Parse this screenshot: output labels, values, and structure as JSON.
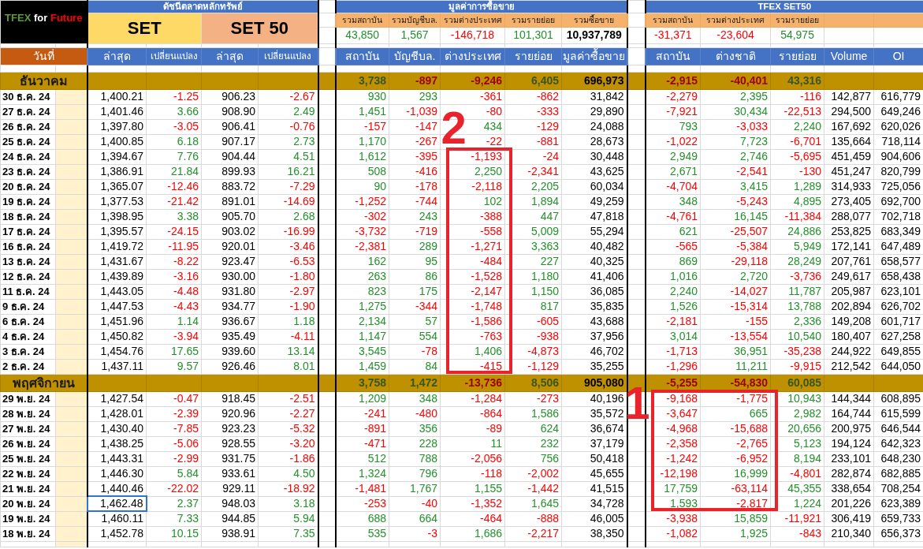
{
  "logo": [
    {
      "text": "TFEX",
      "color": "#5b9b3a"
    },
    {
      "text": "for",
      "color": "#ffffff"
    },
    {
      "text": "Future",
      "color": "#ff0000"
    }
  ],
  "date_header": "วันที่",
  "set_section": {
    "title": "ดัชนีตลาดหลักทรัพย์",
    "indices": [
      {
        "name": "SET",
        "columns": [
          "ล่าสุด",
          "เปลี่ยนแปลง"
        ]
      },
      {
        "name": "SET 50",
        "columns": [
          "ล่าสุด",
          "เปลี่ยนแปลง"
        ]
      }
    ]
  },
  "flow_section": {
    "title": "มูลค่าการซื้อขาย",
    "summary_labels": [
      "รวมสถาบัน",
      "รวมบัญชีบล.",
      "รวมต่างประเทศ",
      "รวมรายย่อย",
      "รวมซื้อขาย"
    ],
    "summary_values": [
      "43,850",
      "1,567",
      "-146,718",
      "101,301",
      "10,937,789"
    ],
    "columns": [
      "สถาบัน",
      "บัญชีบล.",
      "ต่างประเทศ",
      "รายย่อย",
      "มูลค่าซื้อขาย"
    ]
  },
  "tfex_section": {
    "title": "TFEX SET50",
    "summary_labels": [
      "รวมสถาบัน",
      "รวมต่างประเทศ",
      "รวมรายย่อย"
    ],
    "summary_values": [
      "-31,371",
      "-23,604",
      "54,975"
    ],
    "columns": [
      "สถาบัน",
      "ต่างชาติ",
      "รายย่อย",
      "Volume",
      "OI"
    ]
  },
  "months": [
    {
      "name": "ธันวาคม",
      "flow_totals": [
        "3,738",
        "-897",
        "-9,246",
        "6,405",
        "696,973"
      ],
      "tfex_totals": [
        "-2,915",
        "-40,401",
        "43,316"
      ],
      "rows": [
        {
          "date": "30 ธ.ค. 24",
          "set": [
            "1,400.21",
            "-1.25"
          ],
          "set50": [
            "906.23",
            "-2.67"
          ],
          "flow": [
            "930",
            "293",
            "-361",
            "-862",
            "31,842"
          ],
          "tfex": [
            "-2,279",
            "2,395",
            "-116",
            "142,877",
            "616,779"
          ],
          "selected": false
        },
        {
          "date": "27 ธ.ค. 24",
          "set": [
            "1,401.46",
            "3.66"
          ],
          "set50": [
            "908.90",
            "2.49"
          ],
          "flow": [
            "1,451",
            "-1,039",
            "-80",
            "-333",
            "29,890"
          ],
          "tfex": [
            "-7,921",
            "30,434",
            "-22,513",
            "294,500",
            "649,246"
          ],
          "selected": false
        },
        {
          "date": "26 ธ.ค. 24",
          "set": [
            "1,397.80",
            "-3.05"
          ],
          "set50": [
            "906.41",
            "-0.76"
          ],
          "flow": [
            "-157",
            "-147",
            "434",
            "-129",
            "24,088"
          ],
          "tfex": [
            "793",
            "-3,033",
            "2,240",
            "167,692",
            "620,026"
          ],
          "selected": false
        },
        {
          "date": "25 ธ.ค. 24",
          "set": [
            "1,400.85",
            "6.18"
          ],
          "set50": [
            "907.17",
            "2.73"
          ],
          "flow": [
            "1,170",
            "-267",
            "-22",
            "-881",
            "28,673"
          ],
          "tfex": [
            "-1,022",
            "7,723",
            "-6,701",
            "135,664",
            "718,114"
          ],
          "selected": false
        },
        {
          "date": "24 ธ.ค. 24",
          "set": [
            "1,394.67",
            "7.76"
          ],
          "set50": [
            "904.44",
            "4.51"
          ],
          "flow": [
            "1,612",
            "-395",
            "-1,193",
            "-24",
            "30,448"
          ],
          "tfex": [
            "2,949",
            "2,746",
            "-5,695",
            "451,459",
            "904,606"
          ],
          "selected": false
        },
        {
          "date": "23 ธ.ค. 24",
          "set": [
            "1,386.91",
            "21.84"
          ],
          "set50": [
            "899.93",
            "16.21"
          ],
          "flow": [
            "508",
            "-416",
            "2,250",
            "-2,341",
            "43,625"
          ],
          "tfex": [
            "2,671",
            "-2,541",
            "-130",
            "451,247",
            "820,799"
          ],
          "selected": false
        },
        {
          "date": "20 ธ.ค. 24",
          "set": [
            "1,365.07",
            "-12.46"
          ],
          "set50": [
            "883.72",
            "-7.29"
          ],
          "flow": [
            "90",
            "-178",
            "-2,118",
            "2,205",
            "60,034"
          ],
          "tfex": [
            "-4,704",
            "3,415",
            "1,289",
            "314,933",
            "725,056"
          ],
          "selected": false
        },
        {
          "date": "19 ธ.ค. 24",
          "set": [
            "1,377.53",
            "-21.42"
          ],
          "set50": [
            "891.01",
            "-14.69"
          ],
          "flow": [
            "-1,252",
            "-744",
            "102",
            "1,894",
            "49,259"
          ],
          "tfex": [
            "348",
            "-5,243",
            "4,895",
            "273,405",
            "692,700"
          ],
          "selected": false
        },
        {
          "date": "18 ธ.ค. 24",
          "set": [
            "1,398.95",
            "3.38"
          ],
          "set50": [
            "905.70",
            "2.68"
          ],
          "flow": [
            "-302",
            "243",
            "-388",
            "447",
            "47,818"
          ],
          "tfex": [
            "-4,761",
            "16,145",
            "-11,384",
            "288,077",
            "702,718"
          ],
          "selected": false
        },
        {
          "date": "17 ธ.ค. 24",
          "set": [
            "1,395.57",
            "-24.15"
          ],
          "set50": [
            "903.02",
            "-16.99"
          ],
          "flow": [
            "-3,732",
            "-719",
            "-558",
            "5,009",
            "55,294"
          ],
          "tfex": [
            "621",
            "-25,507",
            "24,886",
            "253,825",
            "683,349"
          ],
          "selected": false
        },
        {
          "date": "16 ธ.ค. 24",
          "set": [
            "1,419.72",
            "-11.95"
          ],
          "set50": [
            "920.01",
            "-3.46"
          ],
          "flow": [
            "-2,381",
            "289",
            "-1,271",
            "3,363",
            "40,482"
          ],
          "tfex": [
            "-565",
            "-5,384",
            "5,949",
            "172,141",
            "647,489"
          ],
          "selected": false
        },
        {
          "date": "13 ธ.ค. 24",
          "set": [
            "1,431.67",
            "-8.22"
          ],
          "set50": [
            "923.47",
            "-6.53"
          ],
          "flow": [
            "162",
            "95",
            "-484",
            "227",
            "40,325"
          ],
          "tfex": [
            "869",
            "-29,118",
            "28,249",
            "207,761",
            "658,577"
          ],
          "selected": false
        },
        {
          "date": "12 ธ.ค. 24",
          "set": [
            "1,439.89",
            "-3.16"
          ],
          "set50": [
            "930.00",
            "-1.80"
          ],
          "flow": [
            "263",
            "86",
            "-1,528",
            "1,180",
            "41,406"
          ],
          "tfex": [
            "1,016",
            "2,720",
            "-3,736",
            "249,617",
            "658,438"
          ],
          "selected": false
        },
        {
          "date": "11 ธ.ค. 24",
          "set": [
            "1,443.05",
            "-4.48"
          ],
          "set50": [
            "931.80",
            "-2.97"
          ],
          "flow": [
            "823",
            "175",
            "-2,147",
            "1,150",
            "36,085"
          ],
          "tfex": [
            "2,240",
            "-14,027",
            "11,787",
            "205,987",
            "623,101"
          ],
          "selected": false
        },
        {
          "date": "9 ธ.ค. 24",
          "set": [
            "1,447.53",
            "-4.43"
          ],
          "set50": [
            "934.77",
            "-1.90"
          ],
          "flow": [
            "1,275",
            "-344",
            "-1,748",
            "817",
            "35,835"
          ],
          "tfex": [
            "1,526",
            "-15,314",
            "13,788",
            "202,894",
            "626,702"
          ],
          "selected": false
        },
        {
          "date": "6 ธ.ค. 24",
          "set": [
            "1,451.96",
            "1.14"
          ],
          "set50": [
            "936.67",
            "1.18"
          ],
          "flow": [
            "2,134",
            "57",
            "-1,586",
            "-605",
            "43,688"
          ],
          "tfex": [
            "-2,181",
            "-155",
            "2,336",
            "149,208",
            "601,717"
          ],
          "selected": false
        },
        {
          "date": "4 ธ.ค. 24",
          "set": [
            "1,450.82",
            "-3.94"
          ],
          "set50": [
            "935.49",
            "-4.11"
          ],
          "flow": [
            "1,147",
            "554",
            "-763",
            "-938",
            "37,956"
          ],
          "tfex": [
            "3,014",
            "-13,554",
            "10,540",
            "180,407",
            "627,258"
          ],
          "selected": false
        },
        {
          "date": "3 ธ.ค. 24",
          "set": [
            "1,454.76",
            "17.65"
          ],
          "set50": [
            "939.60",
            "13.14"
          ],
          "flow": [
            "3,545",
            "-78",
            "1,406",
            "-4,873",
            "46,702"
          ],
          "tfex": [
            "-1,713",
            "36,951",
            "-35,238",
            "244,922",
            "649,855"
          ],
          "selected": false
        },
        {
          "date": "2 ธ.ค. 24",
          "set": [
            "1,437.11",
            "9.57"
          ],
          "set50": [
            "926.46",
            "8.01"
          ],
          "flow": [
            "1,459",
            "84",
            "-415",
            "-1,129",
            "35,255"
          ],
          "tfex": [
            "-1,296",
            "11,211",
            "-9,915",
            "212,542",
            "644,050"
          ],
          "selected": false
        }
      ]
    },
    {
      "name": "พฤศจิกายน",
      "flow_totals": [
        "3,758",
        "1,472",
        "-13,736",
        "8,506",
        "905,080"
      ],
      "tfex_totals": [
        "-5,255",
        "-54,830",
        "60,085"
      ],
      "rows": [
        {
          "date": "29 พ.ย. 24",
          "set": [
            "1,427.54",
            "-0.47"
          ],
          "set50": [
            "918.45",
            "-2.51"
          ],
          "flow": [
            "1,209",
            "348",
            "-1,284",
            "-273",
            "40,196"
          ],
          "tfex": [
            "-9,168",
            "-1,775",
            "10,943",
            "144,344",
            "608,895"
          ],
          "selected": false
        },
        {
          "date": "28 พ.ย. 24",
          "set": [
            "1,428.01",
            "-2.39"
          ],
          "set50": [
            "920.96",
            "-2.27"
          ],
          "flow": [
            "-241",
            "-480",
            "-864",
            "1,586",
            "35,572"
          ],
          "tfex": [
            "-3,647",
            "665",
            "2,982",
            "164,744",
            "615,599"
          ],
          "selected": false
        },
        {
          "date": "27 พ.ย. 24",
          "set": [
            "1,430.40",
            "-7.85"
          ],
          "set50": [
            "923.23",
            "-5.32"
          ],
          "flow": [
            "-891",
            "356",
            "-89",
            "624",
            "36,674"
          ],
          "tfex": [
            "-4,968",
            "-15,688",
            "20,656",
            "200,975",
            "646,544"
          ],
          "selected": false
        },
        {
          "date": "26 พ.ย. 24",
          "set": [
            "1,438.25",
            "-5.06"
          ],
          "set50": [
            "928.55",
            "-3.20"
          ],
          "flow": [
            "-471",
            "228",
            "11",
            "232",
            "37,179"
          ],
          "tfex": [
            "-2,358",
            "-2,765",
            "5,123",
            "194,124",
            "642,323"
          ],
          "selected": false
        },
        {
          "date": "25 พ.ย. 24",
          "set": [
            "1,443.31",
            "-2.99"
          ],
          "set50": [
            "931.75",
            "-1.86"
          ],
          "flow": [
            "512",
            "788",
            "-2,056",
            "756",
            "50,418"
          ],
          "tfex": [
            "-1,242",
            "-6,952",
            "8,194",
            "233,101",
            "648,230"
          ],
          "selected": false
        },
        {
          "date": "22 พ.ย. 24",
          "set": [
            "1,446.30",
            "5.84"
          ],
          "set50": [
            "933.61",
            "4.50"
          ],
          "flow": [
            "1,324",
            "796",
            "-118",
            "-2,002",
            "45,655"
          ],
          "tfex": [
            "-12,198",
            "16,999",
            "-4,801",
            "282,874",
            "682,885"
          ],
          "selected": false
        },
        {
          "date": "21 พ.ย. 24",
          "set": [
            "1,440.46",
            "-22.02"
          ],
          "set50": [
            "929.11",
            "-18.92"
          ],
          "flow": [
            "-1,481",
            "1,767",
            "1,155",
            "-1,442",
            "41,515"
          ],
          "tfex": [
            "17,759",
            "-63,114",
            "45,355",
            "338,654",
            "708,254"
          ],
          "selected": false
        },
        {
          "date": "20 พ.ย. 24",
          "set": [
            "1,462.48",
            "2.37"
          ],
          "set50": [
            "948.03",
            "3.18"
          ],
          "flow": [
            "-253",
            "-40",
            "-1,352",
            "1,645",
            "34,728"
          ],
          "tfex": [
            "1,593",
            "-2,817",
            "1,224",
            "201,226",
            "623,389"
          ],
          "selected": true
        },
        {
          "date": "19 พ.ย. 24",
          "set": [
            "1,460.11",
            "7.33"
          ],
          "set50": [
            "944.85",
            "5.94"
          ],
          "flow": [
            "688",
            "664",
            "-464",
            "-888",
            "46,005"
          ],
          "tfex": [
            "-3,938",
            "15,859",
            "-11,921",
            "306,419",
            "659,733"
          ],
          "selected": false
        },
        {
          "date": "18 พ.ย. 24",
          "set": [
            "1,452.78",
            "10.15"
          ],
          "set50": [
            "938.91",
            "7.35"
          ],
          "flow": [
            "535",
            "-3",
            "1,686",
            "-2,217",
            "38,350"
          ],
          "tfex": [
            "-1,082",
            "1,925",
            "-843",
            "210,340",
            "656,373"
          ],
          "selected": false
        }
      ]
    }
  ],
  "annotations": [
    {
      "label": "2"
    },
    {
      "label": "1"
    }
  ]
}
